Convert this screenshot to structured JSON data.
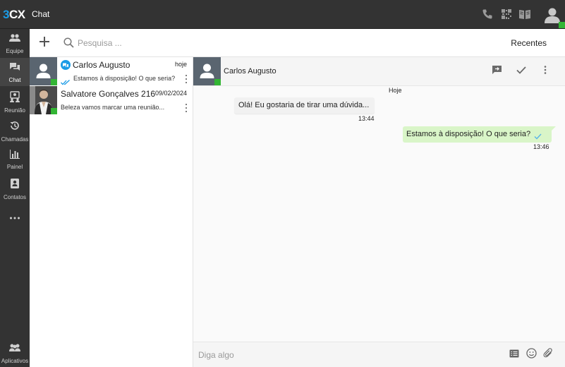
{
  "app": {
    "logo_three": "3",
    "logo_cx": "CX",
    "title": "Chat"
  },
  "colors": {
    "topbar_bg": "#333333",
    "brand_blue": "#1a9be6",
    "status_green": "#33b534",
    "outgoing_bubble": "#d9f5c8"
  },
  "topbar_icons": [
    "phone-icon",
    "qr-code-icon",
    "book-icon",
    "user-avatar-icon"
  ],
  "nav": {
    "items": [
      {
        "label": "Equipe",
        "icon": "team-icon"
      },
      {
        "label": "Chat",
        "icon": "chat-icon"
      },
      {
        "label": "Reunião",
        "icon": "meeting-icon"
      },
      {
        "label": "Chamadas",
        "icon": "history-icon"
      },
      {
        "label": "Painel",
        "icon": "bar-chart-icon"
      },
      {
        "label": "Contatos",
        "icon": "contacts-icon"
      },
      {
        "label": "",
        "icon": "more-icon"
      },
      {
        "label": "Aplicativos",
        "icon": "apps-icon"
      }
    ]
  },
  "toolbar": {
    "search_placeholder": "Pesquisa ...",
    "recent_label": "Recentes"
  },
  "conversations": [
    {
      "name": "Carlos Augusto",
      "date": "hoje",
      "preview": "Estamos à disposição! O que seria?",
      "icon": "chat-bubble-icon",
      "status": "read-check"
    },
    {
      "name": "Salvatore Gonçalves 216",
      "date": "09/02/2024",
      "preview": "Beleza vamos marcar uma reunião...",
      "icon": "",
      "status": ""
    }
  ],
  "chat": {
    "contact_name": "Carlos Augusto",
    "day_label": "Hoje",
    "messages": [
      {
        "direction": "in",
        "text": "Olá! Eu gostaria de tirar uma dúvida...",
        "time": "13:44"
      },
      {
        "direction": "out",
        "text": "Estamos à disposição! O que seria?",
        "time": "13:46"
      }
    ],
    "composer_placeholder": "Diga algo"
  }
}
